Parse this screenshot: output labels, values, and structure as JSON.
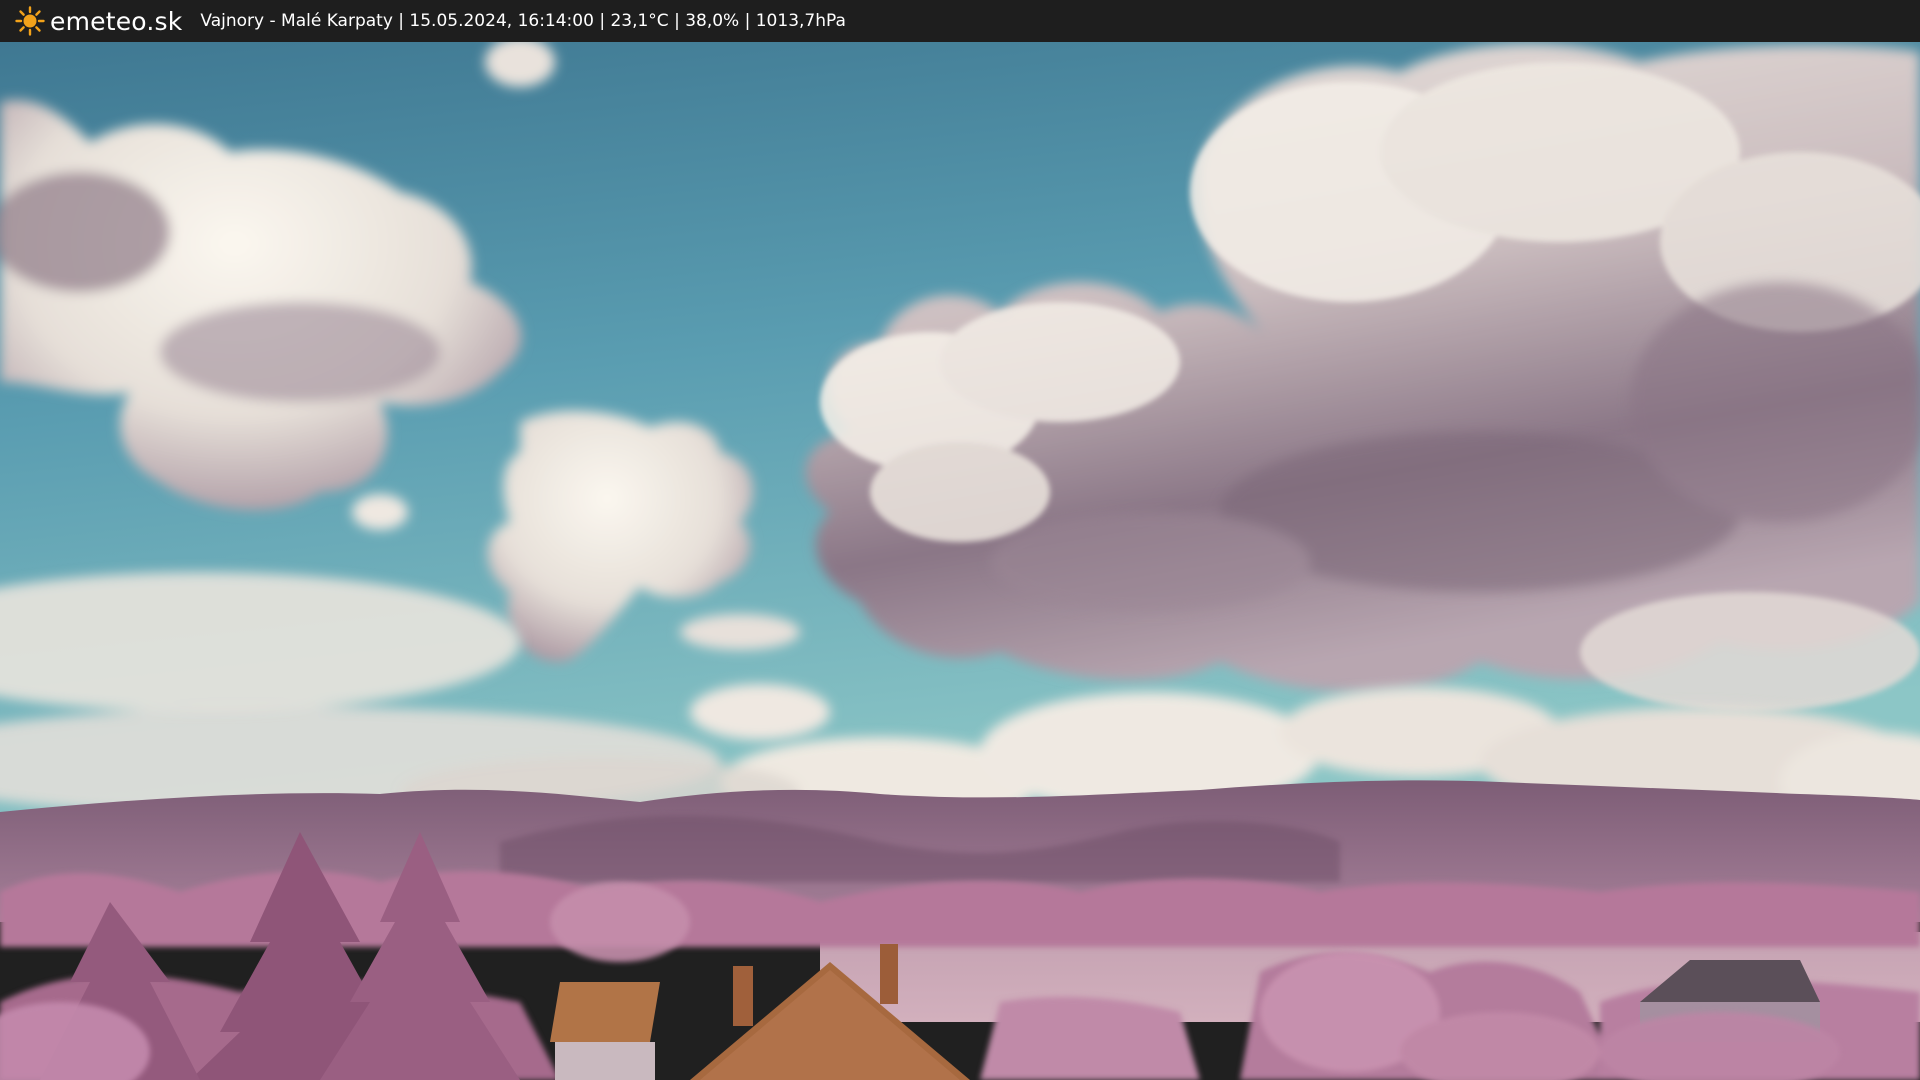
{
  "header": {
    "brand": "emeteo.sk",
    "caption": "Vajnory - Malé Karpaty | 15.05.2024, 16:14:00 | 23,1°C | 38,0% | 1013,7hPa",
    "icon": "sun-icon",
    "background_color": "#1e1e1e",
    "text_color": "#ffffff",
    "icon_color": "#f2a21a"
  },
  "webcam": {
    "scene": "infrared landscape webcam",
    "colors": {
      "sky_top": "#4b86a0",
      "sky_bottom": "#7fbcc2",
      "cloud": "#f1ece6",
      "cloud_shadow": "#a18f9b",
      "hills": "#8d6c85",
      "vegetation": "#b9789c",
      "field": "#c79fb0",
      "roof": "#a86a3e"
    }
  }
}
